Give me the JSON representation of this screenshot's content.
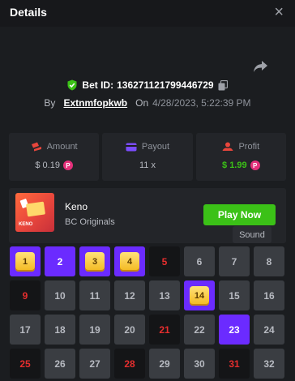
{
  "header": {
    "title": "Details",
    "close_glyph": "×"
  },
  "bet": {
    "id_label": "Bet ID:",
    "id_value": "136271121799446729",
    "by_label": "By",
    "username": "Extnmfopkwb",
    "on_label": "On",
    "datetime": "4/28/2023, 5:22:39 PM"
  },
  "stats": {
    "amount": {
      "label": "Amount",
      "value": "$ 0.19"
    },
    "payout": {
      "label": "Payout",
      "value": "11 x"
    },
    "profit": {
      "label": "Profit",
      "value": "$ 1.99"
    },
    "coin_glyph": "P"
  },
  "game": {
    "name": "Keno",
    "provider": "BC Originals",
    "play_label": "Play Now",
    "thumb_label": "KENO"
  },
  "tooltip": "Sound",
  "colors": {
    "background": "#1b1d20",
    "panel": "#232529",
    "green": "#3bc117",
    "purple": "#6b2bff",
    "red": "#e62e2e",
    "gold": "#f3b81e"
  },
  "grid": {
    "tiles": [
      {
        "n": "1",
        "state": "hit"
      },
      {
        "n": "2",
        "state": "pick"
      },
      {
        "n": "3",
        "state": "hit"
      },
      {
        "n": "4",
        "state": "hit"
      },
      {
        "n": "5",
        "state": "miss"
      },
      {
        "n": "6",
        "state": "plain"
      },
      {
        "n": "7",
        "state": "plain"
      },
      {
        "n": "8",
        "state": "plain"
      },
      {
        "n": "9",
        "state": "miss"
      },
      {
        "n": "10",
        "state": "plain"
      },
      {
        "n": "11",
        "state": "plain"
      },
      {
        "n": "12",
        "state": "plain"
      },
      {
        "n": "13",
        "state": "plain"
      },
      {
        "n": "14",
        "state": "hit"
      },
      {
        "n": "15",
        "state": "plain"
      },
      {
        "n": "16",
        "state": "plain"
      },
      {
        "n": "17",
        "state": "plain"
      },
      {
        "n": "18",
        "state": "plain"
      },
      {
        "n": "19",
        "state": "plain"
      },
      {
        "n": "20",
        "state": "plain"
      },
      {
        "n": "21",
        "state": "miss"
      },
      {
        "n": "22",
        "state": "plain"
      },
      {
        "n": "23",
        "state": "pick"
      },
      {
        "n": "24",
        "state": "plain"
      },
      {
        "n": "25",
        "state": "miss"
      },
      {
        "n": "26",
        "state": "plain"
      },
      {
        "n": "27",
        "state": "plain"
      },
      {
        "n": "28",
        "state": "miss"
      },
      {
        "n": "29",
        "state": "plain"
      },
      {
        "n": "30",
        "state": "plain"
      },
      {
        "n": "31",
        "state": "miss"
      },
      {
        "n": "32",
        "state": "plain"
      }
    ]
  }
}
